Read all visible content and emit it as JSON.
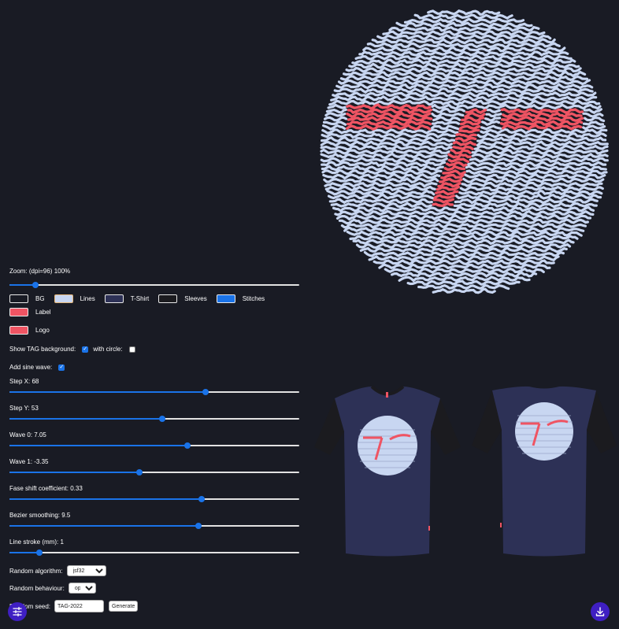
{
  "colors": {
    "background": "#191b24",
    "lines": "#c8d6f1",
    "tshirt": "#2d3156",
    "sleeves": "#1b1b1f",
    "stitches": "#1a73e8",
    "label": "#ef5463",
    "logo": "#ef5463",
    "accent": "#1a73e8",
    "fab": "#3f1fc3"
  },
  "controls": {
    "zoom": {
      "label": "Zoom: (dpi=96) 100%",
      "position": 0.09
    },
    "swatches": [
      {
        "id": "bg",
        "label": "BG",
        "color": "#191b24"
      },
      {
        "id": "lines",
        "label": "Lines",
        "color": "#c8d6f1"
      },
      {
        "id": "tshirt",
        "label": "T-Shirt",
        "color": "#2d3156"
      },
      {
        "id": "sleeves",
        "label": "Sleeves",
        "color": "#1b1b1f"
      },
      {
        "id": "stitches",
        "label": "Stitches",
        "color": "#1a73e8"
      },
      {
        "id": "label",
        "label": "Label",
        "color": "#ef5463"
      },
      {
        "id": "logo",
        "label": "Logo",
        "color": "#ef5463"
      }
    ],
    "show_tag_background": {
      "label": "Show TAG background:",
      "checked": true
    },
    "with_circle": {
      "label": "with circle:",
      "checked": false
    },
    "sine_wave": {
      "label": "Add sine wave:",
      "checked": true
    },
    "sliders": [
      {
        "id": "step-x",
        "label": "Step X: 68",
        "position": 0.677
      },
      {
        "id": "step-y",
        "label": "Step Y: 53",
        "position": 0.526
      },
      {
        "id": "wave-0",
        "label": "Wave 0: 7.05",
        "position": 0.615
      },
      {
        "id": "wave-1",
        "label": "Wave 1: -3.35",
        "position": 0.449
      },
      {
        "id": "phase",
        "label": "Fase shift coefficient: 0.33",
        "position": 0.663
      },
      {
        "id": "bezier",
        "label": "Bezier smoothing: 9.5",
        "position": 0.651
      },
      {
        "id": "stroke",
        "label": "Line stroke (mm): 1",
        "position": 0.104
      }
    ],
    "random_algorithm": {
      "label": "Random algorithm:",
      "value": "jsf32"
    },
    "random_behaviour": {
      "label": "Random behaviour:",
      "value": "option 1"
    },
    "random_seed": {
      "label": "Random seed:",
      "value": "TAG-2022",
      "button": "Generate"
    }
  },
  "icons": {
    "settings": "sliders-icon",
    "download": "download-icon"
  }
}
